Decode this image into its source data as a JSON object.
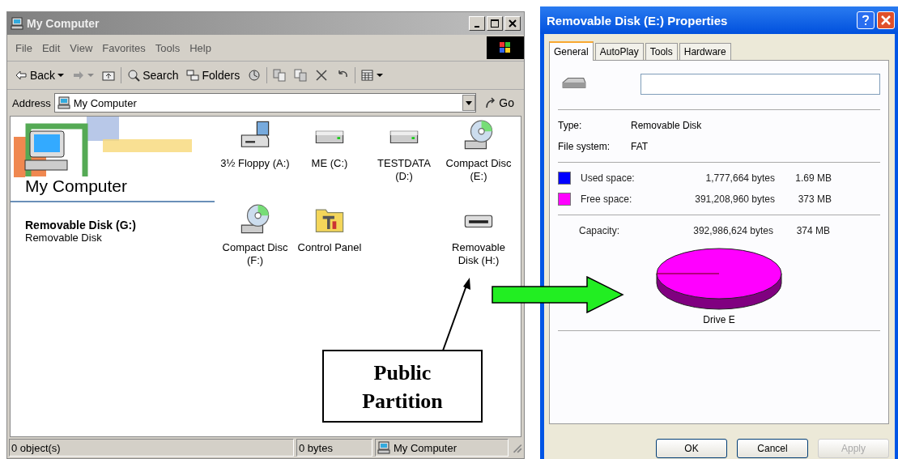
{
  "explorer": {
    "title": "My Computer",
    "menu": [
      "File",
      "Edit",
      "View",
      "Favorites",
      "Tools",
      "Help"
    ],
    "toolbar": [
      {
        "kind": "back",
        "label": "Back"
      },
      {
        "kind": "forward"
      },
      {
        "kind": "up"
      },
      {
        "kind": "search",
        "label": "Search"
      },
      {
        "kind": "folders",
        "label": "Folders"
      },
      {
        "kind": "history"
      },
      {
        "kind": "move"
      },
      {
        "kind": "copy"
      },
      {
        "kind": "delete"
      },
      {
        "kind": "undo"
      },
      {
        "kind": "views"
      }
    ],
    "address": {
      "label": "Address",
      "value": "My Computer",
      "go": "Go"
    },
    "banner": "My Computer",
    "selection": {
      "name": "Removable Disk (G:)",
      "type": "Removable Disk"
    },
    "items": [
      {
        "kind": "floppy",
        "label": "3½ Floppy (A:)"
      },
      {
        "kind": "drive",
        "label": "ME (C:)"
      },
      {
        "kind": "drive",
        "label": "TESTDATA (D:)"
      },
      {
        "kind": "cd",
        "label": "Compact Disc (E:)"
      },
      {
        "kind": "cd",
        "label": "Compact Disc (F:)"
      },
      {
        "kind": "control",
        "label": "Control Panel"
      },
      {
        "kind": "removable",
        "label": "Removable Disk (H:)"
      }
    ],
    "status_bar": [
      "0 object(s)",
      "0 bytes",
      "My Computer"
    ]
  },
  "properties": {
    "title": "Removable Disk (E:) Properties",
    "tabs": [
      {
        "label": "General",
        "selected": true
      },
      {
        "label": "AutoPlay",
        "selected": false
      },
      {
        "label": "Tools",
        "selected": false
      },
      {
        "label": "Hardware",
        "selected": false
      }
    ],
    "fields": [
      {
        "label": "Type:",
        "value": "Removable Disk"
      },
      {
        "label": "File system:",
        "value": "FAT"
      }
    ],
    "usage": [
      {
        "label": "Used space:",
        "bytes": "1,777,664 bytes",
        "size": "1.69 MB",
        "color": "#0000ff"
      },
      {
        "label": "Free space:",
        "bytes": "391,208,960 bytes",
        "size": "373 MB",
        "color": "#ff00ff"
      }
    ],
    "capacity": {
      "label": "Capacity:",
      "bytes": "392,986,624 bytes",
      "size": "374 MB"
    },
    "drive_label": "Drive E",
    "buttons": [
      {
        "label": "OK",
        "disabled": false
      },
      {
        "label": "Cancel",
        "disabled": false
      },
      {
        "label": "Apply",
        "disabled": true
      }
    ]
  },
  "callout": "Public Partition"
}
